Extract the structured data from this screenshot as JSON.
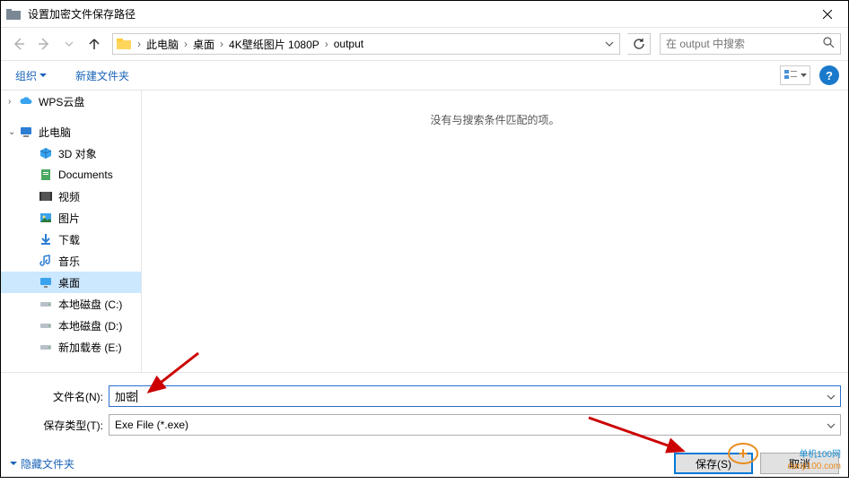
{
  "window": {
    "title": "设置加密文件保存路径"
  },
  "nav": {
    "crumbs": [
      "此电脑",
      "桌面",
      "4K壁纸图片 1080P",
      "output"
    ],
    "search_placeholder": "在 output 中搜索"
  },
  "toolbar": {
    "organize": "组织",
    "new_folder": "新建文件夹"
  },
  "sidebar": {
    "items": [
      {
        "label": "WPS云盘",
        "icon": "cloud",
        "indent": 0
      },
      {
        "label": "此电脑",
        "icon": "pc",
        "indent": 0,
        "expand": true
      },
      {
        "label": "3D 对象",
        "icon": "3d",
        "indent": 1
      },
      {
        "label": "Documents",
        "icon": "doc",
        "indent": 1
      },
      {
        "label": "视频",
        "icon": "video",
        "indent": 1
      },
      {
        "label": "图片",
        "icon": "pic",
        "indent": 1
      },
      {
        "label": "下载",
        "icon": "download",
        "indent": 1
      },
      {
        "label": "音乐",
        "icon": "music",
        "indent": 1
      },
      {
        "label": "桌面",
        "icon": "desktop",
        "indent": 1,
        "selected": true
      },
      {
        "label": "本地磁盘 (C:)",
        "icon": "drive",
        "indent": 1
      },
      {
        "label": "本地磁盘 (D:)",
        "icon": "drive",
        "indent": 1
      },
      {
        "label": "新加载卷 (E:)",
        "icon": "drive",
        "indent": 1
      }
    ]
  },
  "main": {
    "empty_msg": "没有与搜索条件匹配的项。"
  },
  "form": {
    "filename_label": "文件名(N):",
    "filename_value": "加密",
    "type_label": "保存类型(T):",
    "type_value": "Exe File (*.exe)"
  },
  "footer": {
    "hide_folders": "隐藏文件夹",
    "save": "保存(S)",
    "cancel": "取消"
  },
  "watermark": {
    "top": "单机100网",
    "bottom": "danji100.com"
  }
}
